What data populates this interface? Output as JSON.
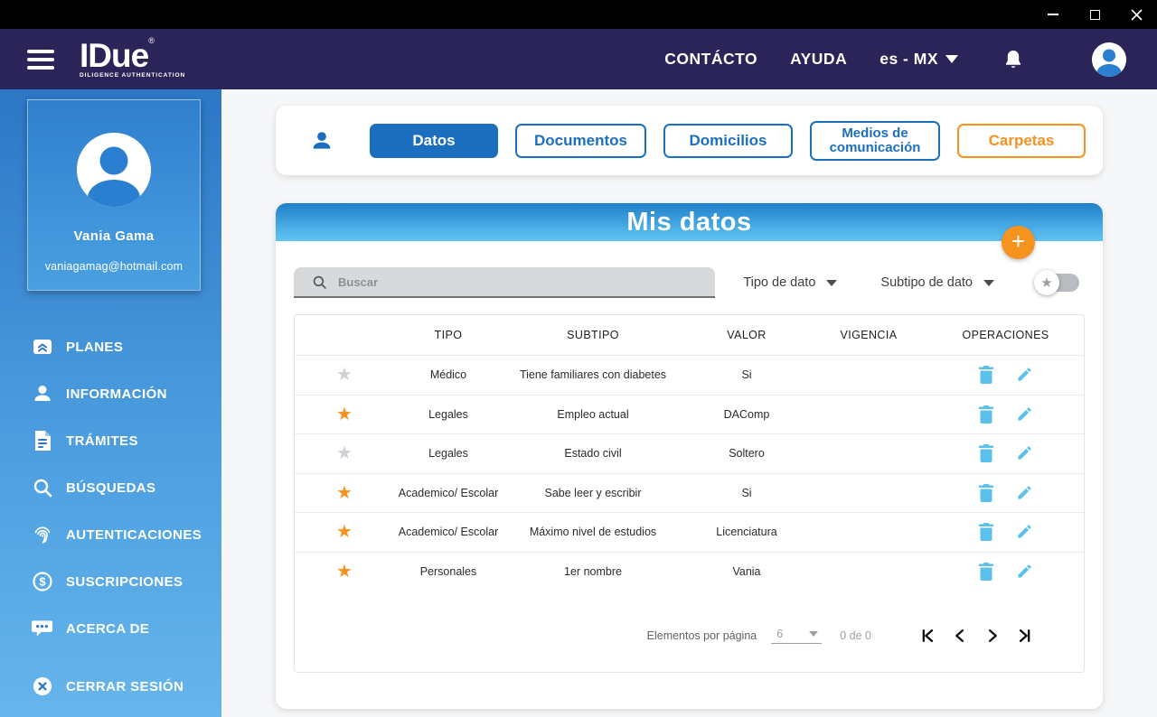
{
  "icons": {
    "star": "★",
    "registered": "®",
    "dollar": "$"
  },
  "colors": {
    "primary_blue": "#1c6fbf",
    "light_blue_icon": "#5bc0ea",
    "orange": "#f6921e",
    "header_navy": "#2a2459",
    "sidebar_blue_top": "#2d77c6",
    "sidebar_blue_bottom": "#66b5ec"
  },
  "header": {
    "logo_title": "IDue",
    "logo_tagline": "DILIGENCE AUTHENTICATION",
    "contact": "CONTÁCTO",
    "help": "AYUDA",
    "locale": "es - MX"
  },
  "sidebar": {
    "profile": {
      "name": "Vania Gama",
      "email": "vaniagamag@hotmail.com"
    },
    "items": [
      {
        "label": "PLANES",
        "icon": "plans-icon"
      },
      {
        "label": "INFORMACIÓN",
        "icon": "person-icon"
      },
      {
        "label": "TRÁMITES",
        "icon": "document-icon"
      },
      {
        "label": "BÚSQUEDAS",
        "icon": "search-icon"
      },
      {
        "label": "AUTENTICACIONES",
        "icon": "fingerprint-icon"
      },
      {
        "label": "SUSCRIPCIONES",
        "icon": "dollar-icon"
      },
      {
        "label": "ACERCA DE",
        "icon": "chat-icon"
      },
      {
        "label": "CERRAR SESIÓN",
        "icon": "logout-icon"
      }
    ]
  },
  "tabs": {
    "items": [
      {
        "label": "Datos",
        "active": true
      },
      {
        "label": "Documentos",
        "active": false
      },
      {
        "label": "Domicilios",
        "active": false
      },
      {
        "label": "Medios de comunicación",
        "active": false
      },
      {
        "label": "Carpetas",
        "active": false,
        "accent": "orange"
      }
    ]
  },
  "panel": {
    "title": "Mis datos",
    "add_button_label": "+",
    "search_placeholder": "Buscar",
    "filter_type_label": "Tipo de dato",
    "filter_subtype_label": "Subtipo de dato",
    "table": {
      "columns": [
        "TIPO",
        "SUBTIPO",
        "VALOR",
        "VIGENCIA",
        "OPERACIONES"
      ],
      "rows": [
        {
          "favorite": false,
          "tipo": "Médico",
          "subtipo": "Tiene familiares con diabetes",
          "valor": "Si",
          "vigencia": ""
        },
        {
          "favorite": true,
          "tipo": "Legales",
          "subtipo": "Empleo actual",
          "valor": "DAComp",
          "vigencia": ""
        },
        {
          "favorite": false,
          "tipo": "Legales",
          "subtipo": "Estado civil",
          "valor": "Soltero",
          "vigencia": ""
        },
        {
          "favorite": true,
          "tipo": "Academico/ Escolar",
          "subtipo": "Sabe leer y escribir",
          "valor": "Si",
          "vigencia": ""
        },
        {
          "favorite": true,
          "tipo": "Academico/ Escolar",
          "subtipo": "Máximo nivel de estudios",
          "valor": "Licenciatura",
          "vigencia": ""
        },
        {
          "favorite": true,
          "tipo": "Personales",
          "subtipo": "1er nombre",
          "valor": "Vania",
          "vigencia": ""
        }
      ]
    },
    "pagination": {
      "items_per_page_label": "Elementos por página",
      "items_per_page": "6",
      "range": "0 de 0"
    }
  }
}
